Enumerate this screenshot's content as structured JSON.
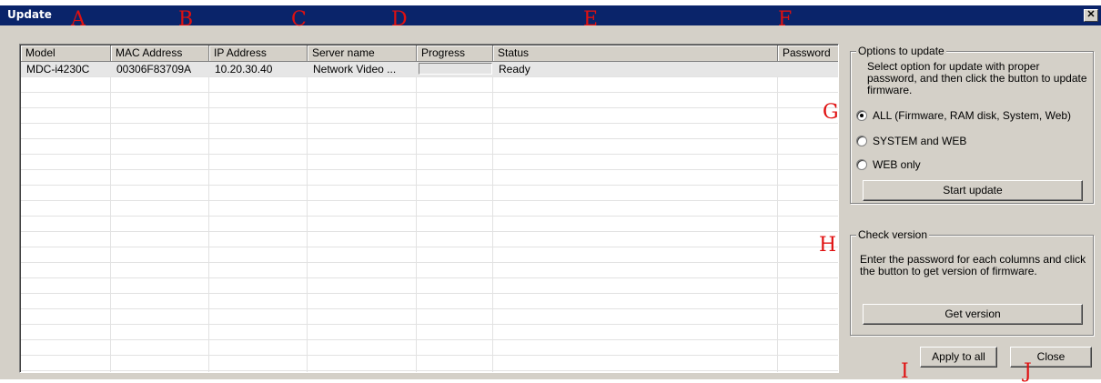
{
  "window": {
    "title": "Update",
    "close_glyph": "✕"
  },
  "annotations": [
    "A",
    "B",
    "C",
    "D",
    "E",
    "F",
    "G",
    "H",
    "I",
    "J"
  ],
  "table": {
    "columns": [
      "Model",
      "MAC Address",
      "IP Address",
      "Server name",
      "Progress",
      "Status",
      "Password"
    ],
    "rows": [
      {
        "model": "MDC-i4230C",
        "mac": "00306F83709A",
        "ip": "10.20.30.40",
        "server": "Network Video ...",
        "progress": 0,
        "status": "Ready",
        "password": ""
      }
    ]
  },
  "options_group": {
    "title": "Options to update",
    "description": "Select option for update with proper password, and then click the button to update firmware.",
    "radios": [
      {
        "label": "ALL (Firmware, RAM disk, System, Web)",
        "checked": true
      },
      {
        "label": "SYSTEM and WEB",
        "checked": false
      },
      {
        "label": "WEB only",
        "checked": false
      }
    ],
    "button": "Start update"
  },
  "check_group": {
    "title": "Check version",
    "description": "Enter the password for each columns and click the button to get version of firmware.",
    "button": "Get version"
  },
  "footer": {
    "apply_button": "Apply to all",
    "close_button": "Close"
  },
  "colors": {
    "titlebar": "#0a246a",
    "face": "#d4d0c8",
    "annotation": "#e01010"
  },
  "icons": {
    "close": "close-icon"
  }
}
